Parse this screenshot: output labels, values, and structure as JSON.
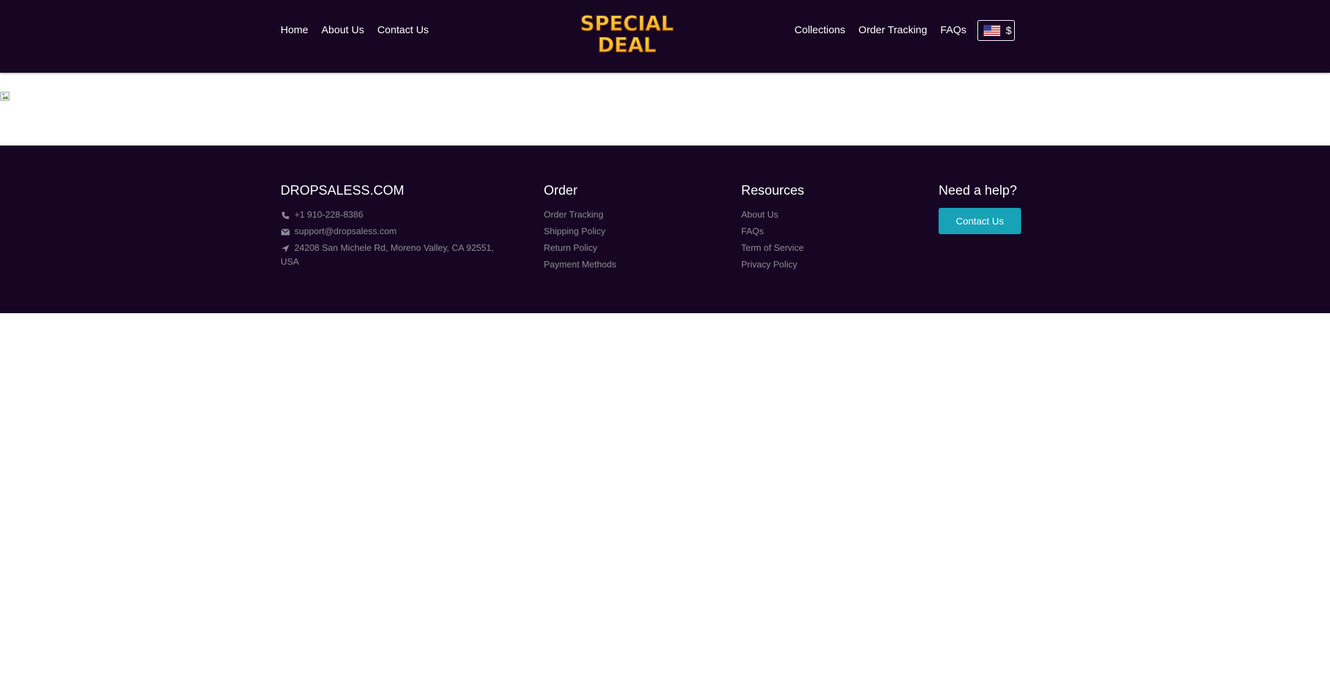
{
  "header": {
    "nav_left": [
      "Home",
      "About Us",
      "Contact Us"
    ],
    "nav_right": [
      "Collections",
      "Order Tracking",
      "FAQs"
    ],
    "logo": {
      "line1": "SPECIAL",
      "line2": "DEAL"
    },
    "currency": {
      "symbol": "$",
      "flag_icon": "us-flag-icon"
    }
  },
  "footer": {
    "brand": {
      "title": "DROPSALESS.COM",
      "phone": "+1 910-228-8386",
      "email": "support@dropsaless.com",
      "address": "24208 San Michele Rd, Moreno Valley, CA 92551, USA"
    },
    "order": {
      "title": "Order",
      "links": [
        "Order Tracking",
        "Shipping Policy",
        "Return Policy",
        "Payment Methods"
      ]
    },
    "resources": {
      "title": "Resources",
      "links": [
        "About Us",
        "FAQs",
        "Term of Service",
        "Privacy Policy"
      ]
    },
    "help": {
      "title": "Need a help?",
      "button": "Contact Us"
    }
  },
  "colors": {
    "header_bg": "#170524",
    "muted_text": "#8e8996",
    "accent": "#17a2b8"
  }
}
